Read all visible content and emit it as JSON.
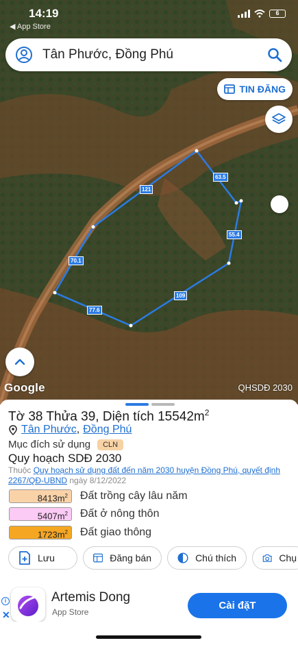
{
  "status": {
    "time": "14:19",
    "back_app": "◀ App Store",
    "battery": "6"
  },
  "search": {
    "query": "Tân Phước, Đồng Phú"
  },
  "map": {
    "tin_dang_label": "TIN ĐĂNG",
    "google_logo": "Google",
    "overlay_label": "QHSDĐ 2030",
    "edge_labels": [
      "121",
      "63.5",
      "55.4",
      "109",
      "77.6",
      "70.1"
    ],
    "polygon_color": "#2b7be3"
  },
  "parcel": {
    "title": "Tờ 38 Thửa 39, Diện tích 15542m",
    "title_sup": "2",
    "commune": "Tân Phước",
    "separator": ",",
    "district": "Đồng Phú",
    "purpose_label": "Mục đích sử dụng",
    "purpose_code": "CLN",
    "plan_title": "Quy hoạch SDĐ 2030",
    "note_prefix": "Thuộc",
    "note_link": "Quy hoạch sử dụng đất đến năm 2030 huyện Đồng Phú, quyết định 2267/QĐ-UBND",
    "note_suffix": "ngày 8/12/2022",
    "land_uses": [
      {
        "area": "8413m",
        "label": "Đất trồng cây lâu năm",
        "color": "#f9d2a8"
      },
      {
        "area": "5407m",
        "label": "Đất ở nông thôn",
        "color": "#fbcaf5"
      },
      {
        "area": "1723m",
        "label": "Đất giao thông",
        "color": "#f5a623"
      }
    ],
    "unit_sup": "2"
  },
  "actions": [
    {
      "label": "Lưu",
      "icon": "add-document-icon"
    },
    {
      "label": "Đăng bán",
      "icon": "listing-icon"
    },
    {
      "label": "Chú thích",
      "icon": "half-circle-icon"
    },
    {
      "label": "Chụ",
      "icon": "camera-icon"
    }
  ],
  "ad": {
    "app_name": "Artemis Dong",
    "store": "App Store",
    "install_label": "Cài đặT",
    "info_mark": "i",
    "close_mark": "✕"
  }
}
